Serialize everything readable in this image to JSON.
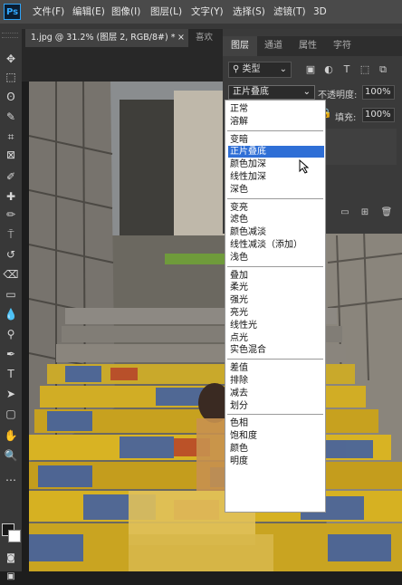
{
  "app": {
    "logo": "Ps",
    "menu": [
      "文件(F)",
      "编辑(E)",
      "图像(I)",
      "图层(L)",
      "文字(Y)",
      "选择(S)",
      "滤镜(T)",
      "3D"
    ]
  },
  "document": {
    "active_tab": "1.jpg @ 31.2% (图层 2, RGB/8#) *",
    "close_glyph": "×",
    "inactive_tab": "喜欢"
  },
  "tools": [
    {
      "icon": "move-tool-icon",
      "glyph": "✥"
    },
    {
      "icon": "marquee-tool-icon",
      "glyph": "⬚"
    },
    {
      "icon": "lasso-tool-icon",
      "glyph": "ʘ"
    },
    {
      "icon": "quick-select-tool-icon",
      "glyph": "✎"
    },
    {
      "icon": "crop-tool-icon",
      "glyph": "⌗"
    },
    {
      "icon": "frame-tool-icon",
      "glyph": "⊠"
    },
    {
      "icon": "eyedropper-tool-icon",
      "glyph": "✐"
    },
    {
      "icon": "healing-brush-icon",
      "glyph": "✚"
    },
    {
      "icon": "brush-tool-icon",
      "glyph": "✏"
    },
    {
      "icon": "stamp-tool-icon",
      "glyph": "⍑"
    },
    {
      "icon": "history-brush-icon",
      "glyph": "↺"
    },
    {
      "icon": "eraser-tool-icon",
      "glyph": "⌫"
    },
    {
      "icon": "gradient-tool-icon",
      "glyph": "▭"
    },
    {
      "icon": "blur-tool-icon",
      "glyph": "💧"
    },
    {
      "icon": "dodge-tool-icon",
      "glyph": "⚲"
    },
    {
      "icon": "pen-tool-icon",
      "glyph": "✒"
    },
    {
      "icon": "type-tool-icon",
      "glyph": "T"
    },
    {
      "icon": "path-select-icon",
      "glyph": "➤"
    },
    {
      "icon": "shape-tool-icon",
      "glyph": "▢"
    },
    {
      "icon": "hand-tool-icon",
      "glyph": "✋"
    },
    {
      "icon": "zoom-tool-icon",
      "glyph": "🔍"
    },
    {
      "icon": "more-tools-icon",
      "glyph": "…"
    }
  ],
  "panel": {
    "tabs": [
      "图层",
      "通道",
      "属性",
      "字符"
    ],
    "active_tab_index": 0,
    "filter_kind": "类型",
    "blend_mode_current": "正片叠底",
    "opacity_label": "不透明度:",
    "opacity_value": "100%",
    "fill_label": "填充:",
    "fill_value": "100%"
  },
  "blend_modes": [
    {
      "group": 1,
      "items": [
        "正常",
        "溶解"
      ]
    },
    {
      "group": 2,
      "items": [
        "变暗",
        "正片叠底",
        "颜色加深",
        "线性加深",
        "深色"
      ]
    },
    {
      "group": 3,
      "items": [
        "变亮",
        "滤色",
        "颜色减淡",
        "线性减淡（添加）",
        "浅色"
      ]
    },
    {
      "group": 4,
      "items": [
        "叠加",
        "柔光",
        "强光",
        "亮光",
        "线性光",
        "点光",
        "实色混合"
      ]
    },
    {
      "group": 5,
      "items": [
        "差值",
        "排除",
        "减去",
        "划分"
      ]
    },
    {
      "group": 6,
      "items": [
        "色相",
        "饱和度",
        "颜色",
        "明度"
      ]
    }
  ],
  "selected_blend_mode": "正片叠底",
  "colors": {
    "accent": "#2f6fd6",
    "ps_blue": "#31a8ff"
  }
}
